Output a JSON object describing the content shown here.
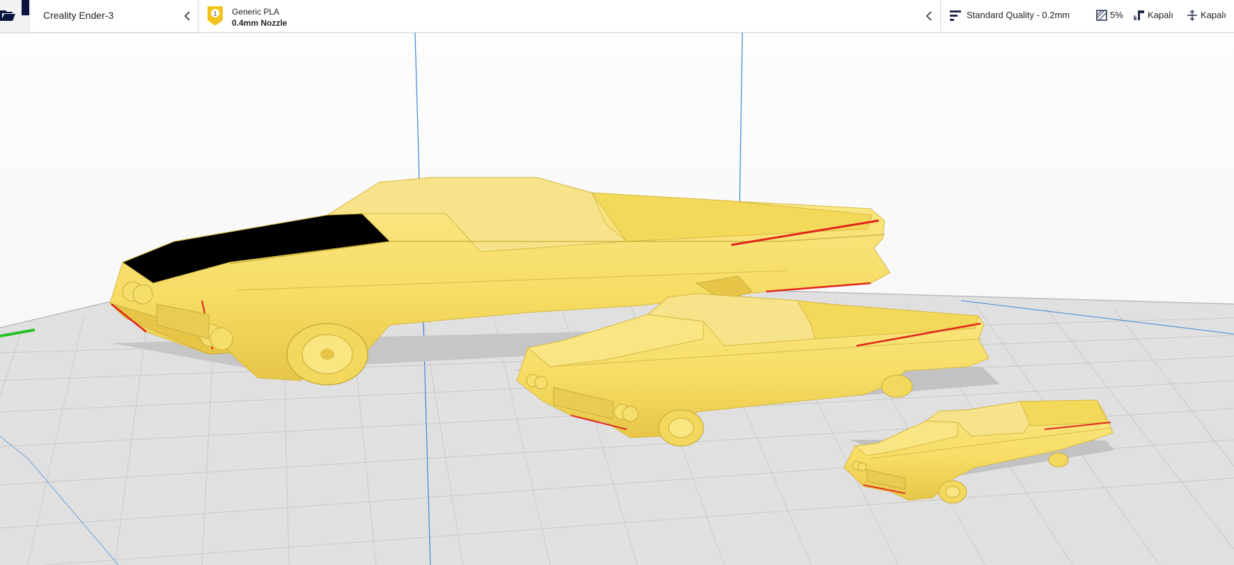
{
  "toolbar": {
    "open_icon": "folder-open-icon",
    "printer": {
      "name": "Creality Ender-3",
      "toggle_icon": "chevron-left-icon"
    },
    "material": {
      "extruder_number": "1",
      "name": "Generic PLA",
      "nozzle": "0.4mm Nozzle",
      "toggle_icon": "chevron-left-icon"
    },
    "print_settings": {
      "quality_icon": "layer-height-icon",
      "quality": "Standard Quality - 0.2mm",
      "infill_icon": "infill-icon",
      "infill": "5%",
      "support_icon": "support-icon",
      "support": "Kapalı",
      "adhesion_icon": "adhesion-icon",
      "adhesion": "Kapalı"
    }
  },
  "viewport": {
    "build_plate_color": "#e0e0e0",
    "grid_line_color": "#c8c8c8",
    "axis_z_color": "#3b86d6",
    "axis_x_color": "#27c127",
    "model_color": "#f9e26e",
    "overhang_color": "#e3241a",
    "models": [
      {
        "name": "car-model-large"
      },
      {
        "name": "car-model-medium"
      },
      {
        "name": "car-model-small"
      }
    ]
  }
}
